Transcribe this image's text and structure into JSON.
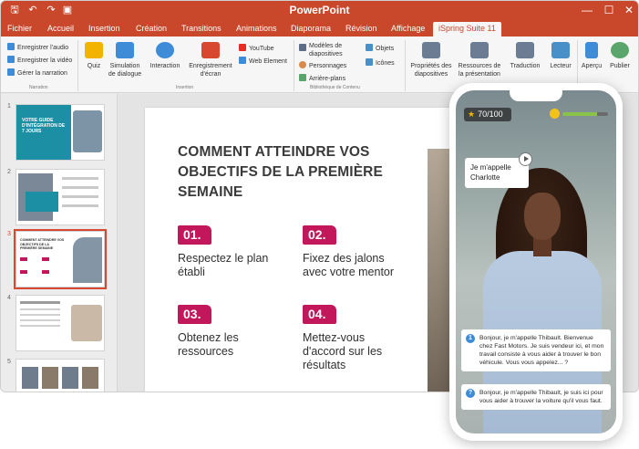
{
  "app": {
    "title": "PowerPoint",
    "window_controls": {
      "minimize": "—",
      "maximize": "☐",
      "close": "✕"
    },
    "quick_access": {
      "save": "🖫",
      "undo": "↶",
      "redo": "↷",
      "present": "▣"
    }
  },
  "tabs": [
    "Fichier",
    "Accueil",
    "Insertion",
    "Création",
    "Transitions",
    "Animations",
    "Diaporama",
    "Révision",
    "Affichage",
    "iSpring Suite 11"
  ],
  "active_tab": "iSpring Suite 11",
  "ribbon": {
    "narration": {
      "label": "Narration",
      "items": [
        "Enregistrer l'audio",
        "Enregistrer la vidéo",
        "Gérer la narration"
      ]
    },
    "insertion": {
      "label": "Insertion",
      "big": [
        "Quiz",
        "Simulation de dialogue",
        "Interaction",
        "Enregistrement d'écran"
      ],
      "small": [
        "YouTube",
        "Web Element"
      ]
    },
    "content_library": {
      "label": "Bibliothèque de Contenu",
      "items": [
        "Modèles de diapositives",
        "Personnages",
        "Arrière-plans"
      ],
      "side": [
        "Objets",
        "Icônes"
      ]
    },
    "publish": {
      "big": [
        "Propriétés des diapositives",
        "Ressources de la présentation",
        "Traduction",
        "Lecteur",
        "Aperçu",
        "Publier"
      ],
      "label": "Publier"
    }
  },
  "thumbnails": [
    {
      "number": "1",
      "title": "VOTRE GUIDE D'INTÉGRATION DE 7 JOURS"
    },
    {
      "number": "2",
      "title": ""
    },
    {
      "number": "3",
      "title": "COMMENT ATTEINDRE VOS OBJECTIFS DE LA PREMIÈRE SEMAINE"
    },
    {
      "number": "4",
      "title": ""
    },
    {
      "number": "5",
      "title": ""
    }
  ],
  "slide": {
    "title": "COMMENT ATTEINDRE VOS OBJECTIFS DE LA PREMIÈRE SEMAINE",
    "steps": [
      {
        "num": "01.",
        "text": "Respectez le plan établi"
      },
      {
        "num": "02.",
        "text": "Fixez des jalons avec votre mentor"
      },
      {
        "num": "03.",
        "text": "Obtenez les ressources"
      },
      {
        "num": "04.",
        "text": "Mettez-vous d'accord sur les résultats"
      }
    ]
  },
  "phone": {
    "score": "70/100",
    "mood_level": 0.75,
    "speech": "Je m'appelle Charlotte",
    "messages": [
      "Bonjour, je m'appelle Thibault. Bienvenue chez Fast Motors. Je suis vendeur ici, et mon travail consiste à vous aider à trouver le bon véhicule. Vous vous appelez... ?",
      "Bonjour, je m'appelle Thibault, je suis ici pour vous aider à trouver la voiture qu'il vous faut."
    ]
  },
  "colors": {
    "accent": "#c9472b",
    "step_badge": "#c2185b",
    "selection": "#d8472f"
  }
}
